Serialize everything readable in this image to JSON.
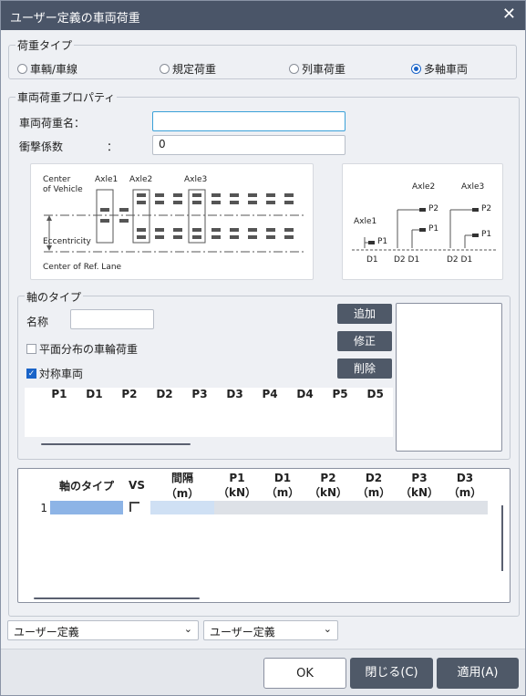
{
  "window": {
    "title": "ユーザー定義の車両荷重",
    "close_icon": "close-icon"
  },
  "load_type": {
    "legend": "荷重タイプ",
    "options": [
      {
        "label": "車輌/車線",
        "selected": false
      },
      {
        "label": "規定荷重",
        "selected": false
      },
      {
        "label": "列車荷重",
        "selected": false
      },
      {
        "label": "多軸車両",
        "selected": true
      }
    ]
  },
  "props": {
    "legend": "車両荷重プロパティ",
    "name_label": "車両荷重名：",
    "name_value": "",
    "impact_label": "衝撃係数",
    "impact_colon": "：",
    "impact_value": "0"
  },
  "diagram_left": {
    "center_vehicle": "Center",
    "center_vehicle2": "of Vehicle",
    "axle1": "Axle1",
    "axle2": "Axle2",
    "axle3": "Axle3",
    "eccentricity": "Eccentricity",
    "center_lane": "Center of Ref. Lane"
  },
  "diagram_right": {
    "axle1": "Axle1",
    "axle2": "Axle2",
    "axle3": "Axle3",
    "p1a": "P1",
    "p1b": "P1",
    "p2b": "P2",
    "p1c": "P1",
    "p2c": "P2",
    "d1": "D1",
    "d2d1a": "D2 D1",
    "d2d1b": "D2 D1"
  },
  "axle_type": {
    "legend": "軸のタイプ",
    "name_label": "名称",
    "name_value": "",
    "plane_dist_label": "平面分布の車輪荷重",
    "plane_dist_checked": false,
    "symmetric_label": "対称車両",
    "symmetric_checked": true,
    "add_label": "追加",
    "modify_label": "修正",
    "delete_label": "削除",
    "columns": [
      "P1",
      "D1",
      "P2",
      "D2",
      "P3",
      "D3",
      "P4",
      "D4",
      "P5",
      "D5"
    ]
  },
  "main_grid": {
    "columns": [
      {
        "l1": "軸のタイプ",
        "l2": ""
      },
      {
        "l1": "VS",
        "l2": ""
      },
      {
        "l1": "間隔",
        "l2": "（m）"
      },
      {
        "l1": "P1",
        "l2": "（kN）"
      },
      {
        "l1": "D1",
        "l2": "（m）"
      },
      {
        "l1": "P2",
        "l2": "（kN）"
      },
      {
        "l1": "D2",
        "l2": "（m）"
      },
      {
        "l1": "P3",
        "l2": "（kN）"
      },
      {
        "l1": "D3",
        "l2": "（m）"
      }
    ],
    "row_number": "1"
  },
  "bottom": {
    "select1": "ユーザー定義",
    "select2": "ユーザー定義",
    "ok": "OK",
    "close": "閉じる(C)",
    "apply": "適用(A)"
  }
}
